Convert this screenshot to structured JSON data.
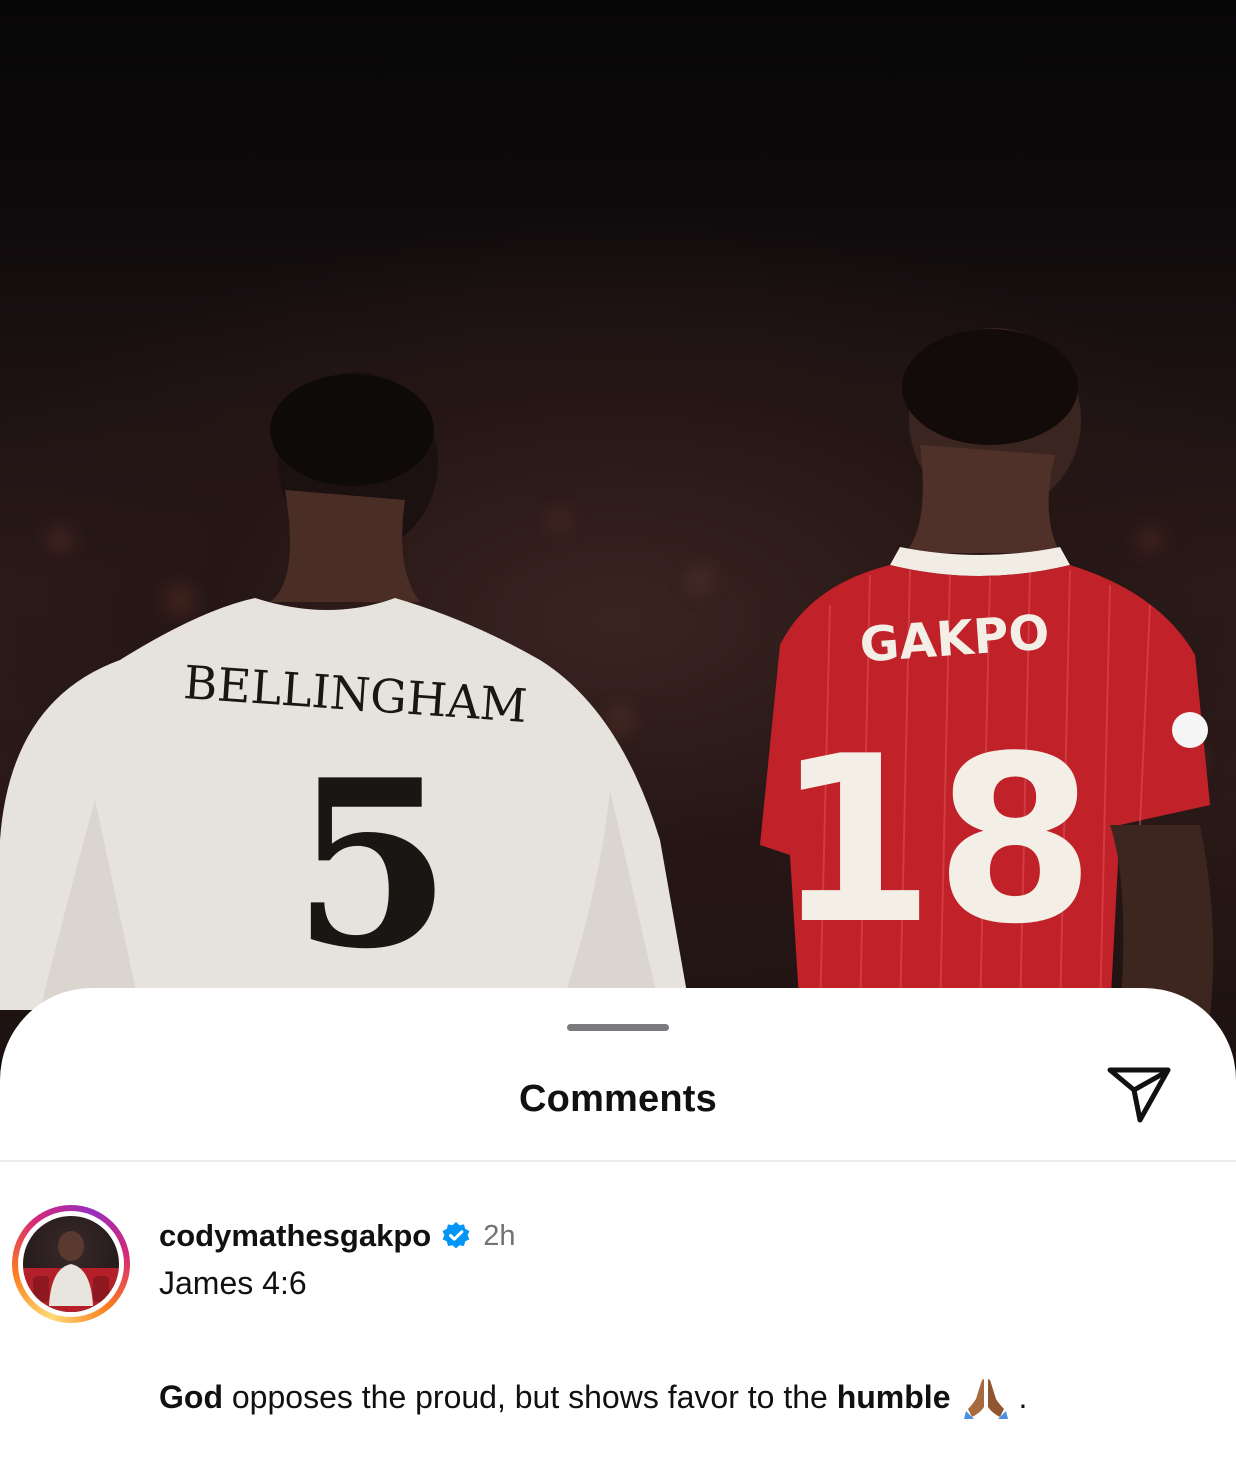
{
  "photo": {
    "left_player": {
      "name": "BELLINGHAM",
      "number": "5"
    },
    "right_player": {
      "name": "GAKPO",
      "number": "18"
    }
  },
  "sheet": {
    "title": "Comments",
    "share_icon": "paper-plane-icon",
    "grabber_icon": "drag-handle"
  },
  "comment": {
    "username": "codymathesgakpo",
    "verified_icon": "verified-badge-icon",
    "time": "2h",
    "line1": "James 4:6",
    "line2_parts": {
      "god": "God",
      "middle": " opposes the proud, but shows favor to the ",
      "humble": "humble",
      "emoji": "praying-hands-icon",
      "end": "."
    }
  },
  "colors": {
    "verified_blue": "#0095f6",
    "liverpool_red": "#c8202a",
    "real_white": "#e9e6e0"
  }
}
